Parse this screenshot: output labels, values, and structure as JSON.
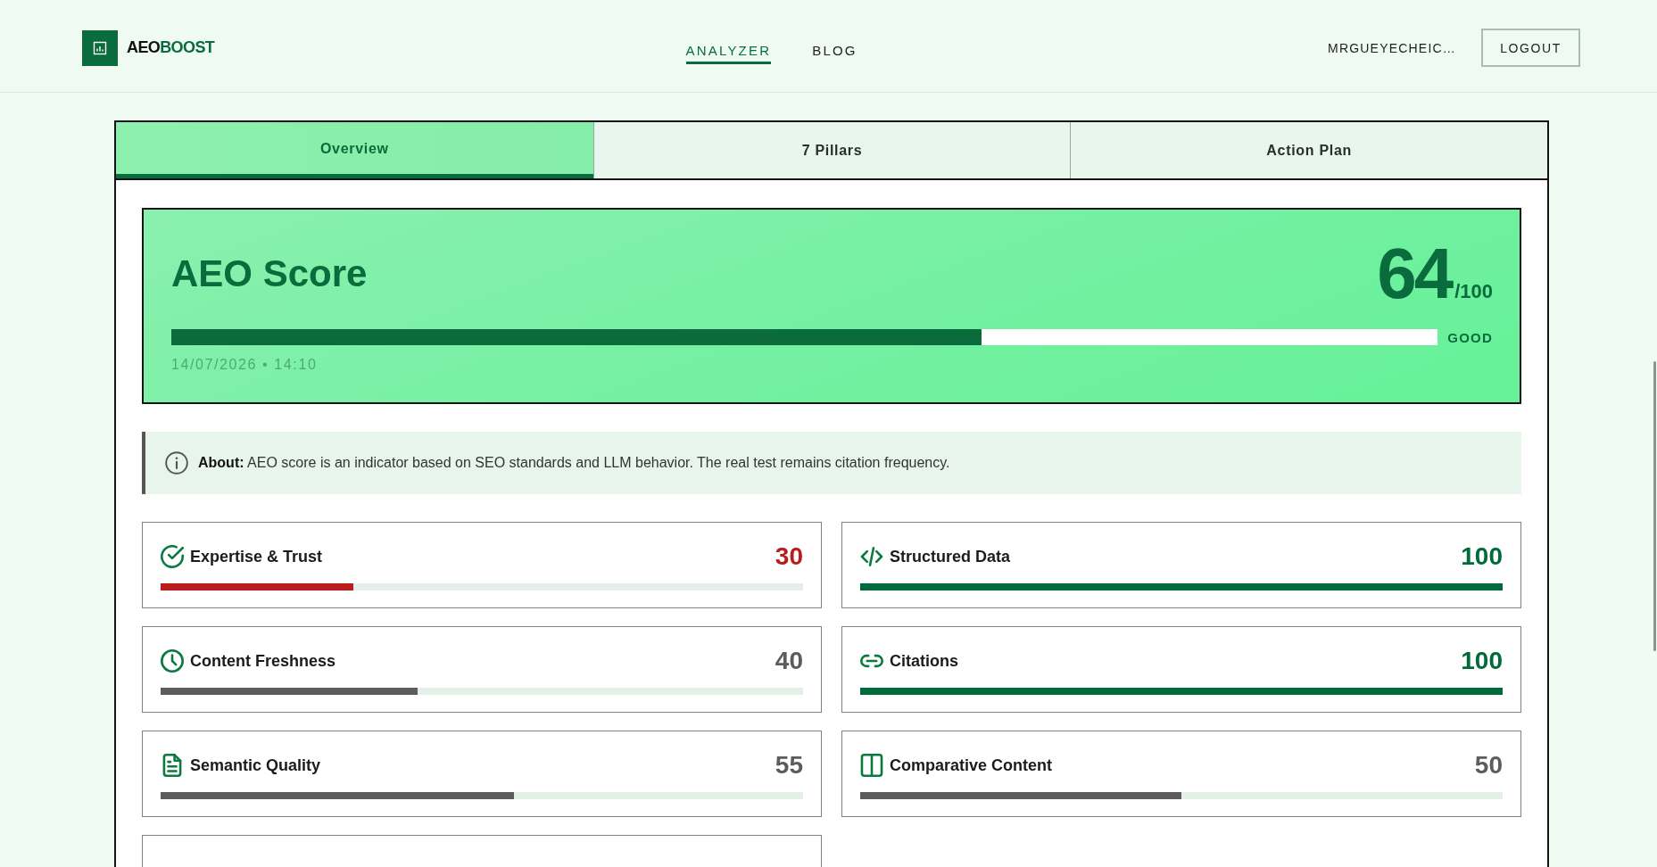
{
  "header": {
    "brand": {
      "parts": [
        "AEO",
        "BOOST"
      ]
    },
    "nav": [
      {
        "label": "ANALYZER",
        "selected": true
      },
      {
        "label": "BLOG",
        "selected": false
      }
    ],
    "user": "MRGUEYECHEIC…",
    "logout": "LOGOUT"
  },
  "tabs": [
    {
      "label": "Overview",
      "selected": true
    },
    {
      "label": "7 Pillars",
      "selected": false
    },
    {
      "label": "Action Plan",
      "selected": false
    }
  ],
  "score": {
    "title": "AEO Score",
    "value": "64",
    "max": "/100",
    "level": 0.64,
    "rating": "GOOD",
    "timestamp": "14/07/2026 • 14:10"
  },
  "about": {
    "text": "**About:** AEO score is an indicator based on SEO standards and LLM behavior. The real test remains citation frequency."
  },
  "pillars": [
    {
      "name": "Expertise & Trust",
      "score": "30",
      "level": 0.3,
      "color": "#b91c1c"
    },
    {
      "name": "Structured Data",
      "score": "100",
      "level": 1.0,
      "color": "#006b3a"
    },
    {
      "name": "Content Freshness",
      "score": "40",
      "level": 0.4,
      "color": "#5c5c5c"
    },
    {
      "name": "Citations",
      "score": "100",
      "level": 1.0,
      "color": "#006b3a"
    },
    {
      "name": "Semantic Quality",
      "score": "55",
      "level": 0.55,
      "color": "#5c5c5c"
    },
    {
      "name": "Comparative Content",
      "score": "50",
      "level": 0.5,
      "color": "#5c5c5c"
    }
  ]
}
